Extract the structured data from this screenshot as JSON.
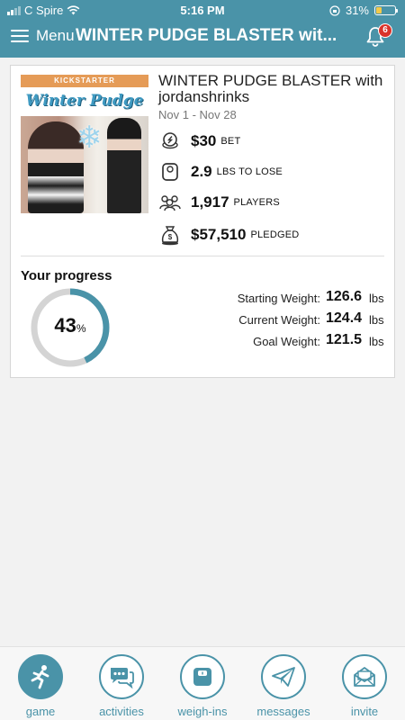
{
  "status_bar": {
    "carrier": "C Spire",
    "time": "5:16 PM",
    "battery": "31%",
    "battery_level": 0.31
  },
  "header": {
    "menu_label": "Menu",
    "title": "WINTER PUDGE BLASTER wit...",
    "notification_count": "6"
  },
  "game": {
    "promo": {
      "banner": "KICKSTARTER",
      "script_title": "Winter Pudge Blaster"
    },
    "name": "WINTER PUDGE BLASTER with jordanshrinks",
    "dates": "Nov 1 - Nov 28",
    "stats": [
      {
        "icon": "coin-bet-icon",
        "value": "$30",
        "unit": "BET"
      },
      {
        "icon": "scale-icon",
        "value": "2.9",
        "unit": "LBS TO LOSE"
      },
      {
        "icon": "players-icon",
        "value": "1,917",
        "unit": "PLAYERS"
      },
      {
        "icon": "money-bag-icon",
        "value": "$57,510",
        "unit": "PLEDGED"
      }
    ]
  },
  "progress": {
    "title": "Your progress",
    "percent": "43",
    "percent_sign": "%",
    "fraction": 0.43,
    "weights": [
      {
        "label": "Starting Weight:",
        "value": "126.6",
        "unit": "lbs"
      },
      {
        "label": "Current Weight:",
        "value": "124.4",
        "unit": "lbs"
      },
      {
        "label": "Goal Weight:",
        "value": "121.5",
        "unit": "lbs"
      }
    ]
  },
  "nav": [
    {
      "label": "game",
      "icon": "runner-icon",
      "active": true
    },
    {
      "label": "activities",
      "icon": "chat-bubbles-icon",
      "active": false
    },
    {
      "label": "weigh-ins",
      "icon": "scale-icon",
      "active": false
    },
    {
      "label": "messages",
      "icon": "paper-plane-icon",
      "active": false
    },
    {
      "label": "invite",
      "icon": "envelope-icon",
      "active": false
    }
  ],
  "colors": {
    "brand": "#4a93a8",
    "badge": "#d9342b",
    "ring_track": "#d4d4d4",
    "ring_fill": "#4a93a8"
  }
}
